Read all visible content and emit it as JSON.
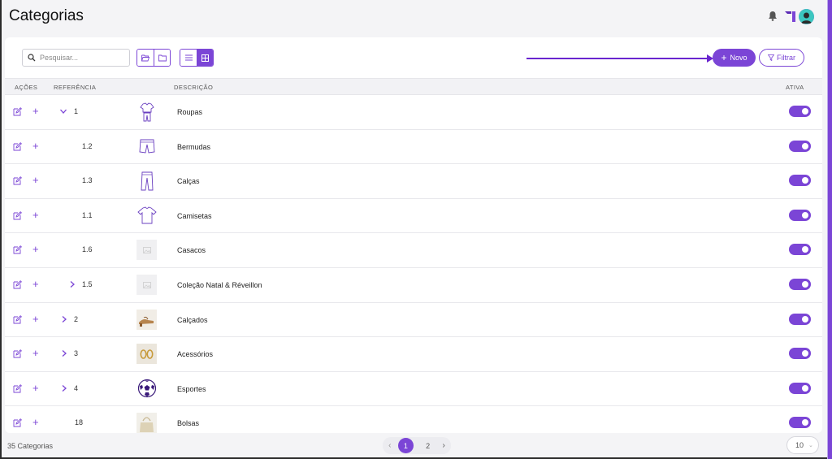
{
  "header": {
    "title": "Categorias"
  },
  "toolbar": {
    "search_placeholder": "Pesquisar...",
    "novo_label": "Novo",
    "filtrar_label": "Filtrar"
  },
  "table": {
    "columns": {
      "acoes": "AÇÕES",
      "referencia": "REFERÊNCIA",
      "descricao": "DESCRIÇÃO",
      "ativa": "ATIVA"
    },
    "rows": [
      {
        "ref": "1",
        "desc": "Roupas",
        "chevron": "down",
        "thumb": "clothes-icon",
        "active": true
      },
      {
        "ref": "1.2",
        "desc": "Bermudas",
        "chevron": "none",
        "thumb": "shorts-icon",
        "active": true
      },
      {
        "ref": "1.3",
        "desc": "Calças",
        "chevron": "none",
        "thumb": "pants-icon",
        "active": true
      },
      {
        "ref": "1.1",
        "desc": "Camisetas",
        "chevron": "none",
        "thumb": "tshirt-icon",
        "active": true
      },
      {
        "ref": "1.6",
        "desc": "Casacos",
        "chevron": "none",
        "thumb": "image-placeholder-icon",
        "active": true
      },
      {
        "ref": "1.5",
        "desc": "Coleção Natal & Réveillon",
        "chevron": "right",
        "thumb": "image-placeholder-icon",
        "active": true
      },
      {
        "ref": "2",
        "desc": "Calçados",
        "chevron": "right",
        "thumb": "sandal-photo",
        "active": true
      },
      {
        "ref": "3",
        "desc": "Acessórios",
        "chevron": "right",
        "thumb": "earrings-photo",
        "active": true
      },
      {
        "ref": "4",
        "desc": "Esportes",
        "chevron": "right",
        "thumb": "soccer-ball-icon",
        "active": true
      },
      {
        "ref": "18",
        "desc": "Bolsas",
        "chevron": "none",
        "thumb": "bag-photo",
        "active": true
      }
    ]
  },
  "footer": {
    "count": "35 Categorias",
    "pages": [
      "1",
      "2"
    ],
    "current_page": "1",
    "page_size": "10"
  },
  "colors": {
    "accent": "#7b45d6",
    "arrow": "#6a26cf"
  }
}
